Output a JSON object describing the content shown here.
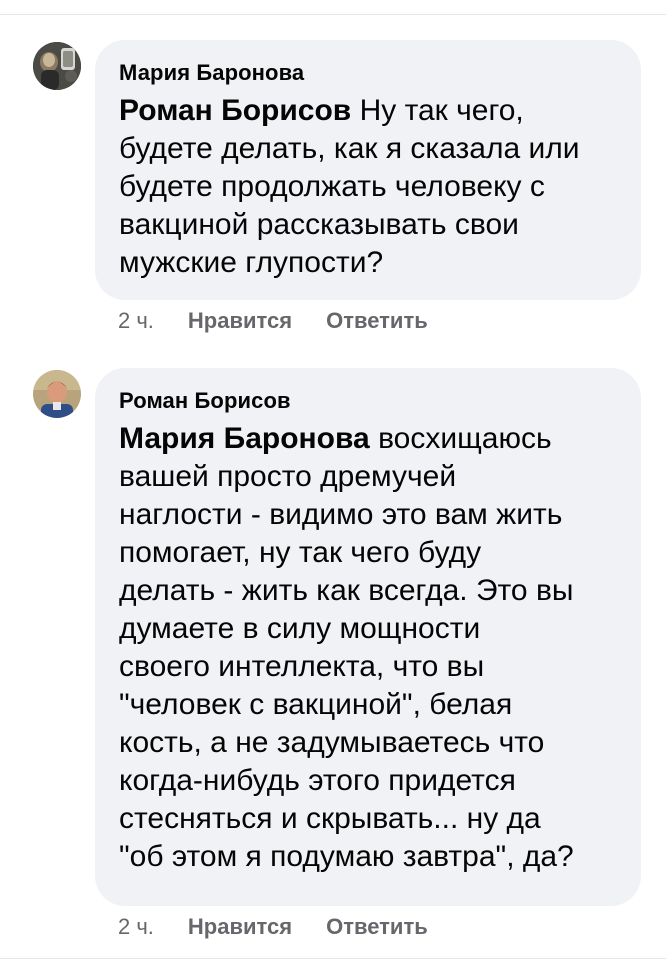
{
  "comments": [
    {
      "author": "Мария Баронова",
      "mention": "Роман Борисов",
      "text": " Ну так чего,\nбудете делать, как я сказала или\nбудете продолжать человеку с\nвакциной рассказывать свои\nмужские глупости?",
      "time": "2 ч.",
      "like_label": "Нравится",
      "reply_label": "Ответить"
    },
    {
      "author": "Роман Борисов",
      "mention": "Мария Баронова",
      "text": " восхищаюсь\nвашей просто дремучей\nнаглости - видимо это вам жить\nпомогает, ну так чего буду\nделать - жить как всегда. Это вы\nдумаете в силу мощности\nсвоего интеллекта, что вы\n\"человек с вакциной\", белая\nкость, а не задумываетесь что\nкогда-нибудь этого придется\nстесняться и скрывать... ну да\n\"об этом я подумаю завтра\", да?",
      "time": "2 ч.",
      "like_label": "Нравится",
      "reply_label": "Ответить"
    }
  ]
}
